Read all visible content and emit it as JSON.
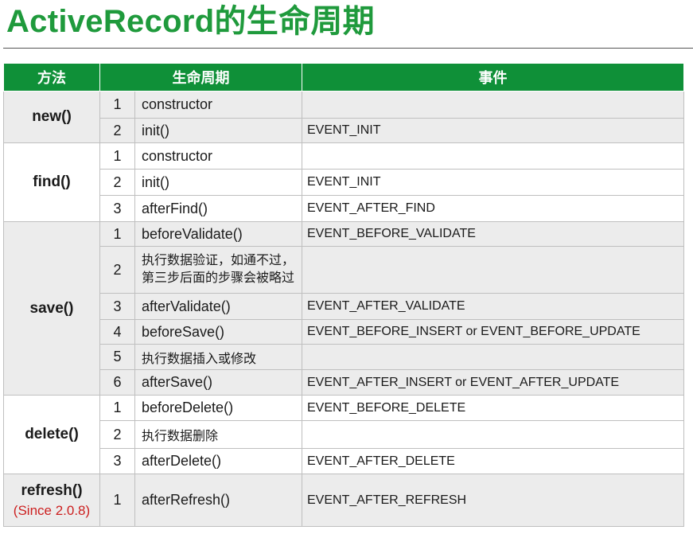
{
  "title": "ActiveRecord的生命周期",
  "table": {
    "headers": [
      "方法",
      "生命周期",
      "事件"
    ],
    "groups": [
      {
        "method": "new()",
        "rows": [
          {
            "num": "1",
            "step": "constructor",
            "event": ""
          },
          {
            "num": "2",
            "step": "init()",
            "event": "EVENT_INIT"
          }
        ]
      },
      {
        "method": "find()",
        "rows": [
          {
            "num": "1",
            "step": "constructor",
            "event": ""
          },
          {
            "num": "2",
            "step": "init()",
            "event": "EVENT_INIT"
          },
          {
            "num": "3",
            "step": "afterFind()",
            "event": "EVENT_AFTER_FIND"
          }
        ]
      },
      {
        "method": "save()",
        "rows": [
          {
            "num": "1",
            "step": "beforeValidate()",
            "event": "EVENT_BEFORE_VALIDATE"
          },
          {
            "num": "2",
            "step": "执行数据验证，如通不过，第三步后面的步骤会被略过",
            "event": ""
          },
          {
            "num": "3",
            "step": "afterValidate()",
            "event": "EVENT_AFTER_VALIDATE"
          },
          {
            "num": "4",
            "step": "beforeSave()",
            "event": "EVENT_BEFORE_INSERT or EVENT_BEFORE_UPDATE"
          },
          {
            "num": "5",
            "step": "执行数据插入或修改",
            "event": ""
          },
          {
            "num": "6",
            "step": "afterSave()",
            "event": "EVENT_AFTER_INSERT or EVENT_AFTER_UPDATE"
          }
        ]
      },
      {
        "method": "delete()",
        "rows": [
          {
            "num": "1",
            "step": "beforeDelete()",
            "event": "EVENT_BEFORE_DELETE"
          },
          {
            "num": "2",
            "step": "执行数据删除",
            "event": ""
          },
          {
            "num": "3",
            "step": "afterDelete()",
            "event": "EVENT_AFTER_DELETE"
          }
        ]
      },
      {
        "method": "refresh()",
        "note": "(Since 2.0.8)",
        "rows": [
          {
            "num": "1",
            "step": "afterRefresh()",
            "event": "EVENT_AFTER_REFRESH"
          }
        ]
      }
    ]
  }
}
